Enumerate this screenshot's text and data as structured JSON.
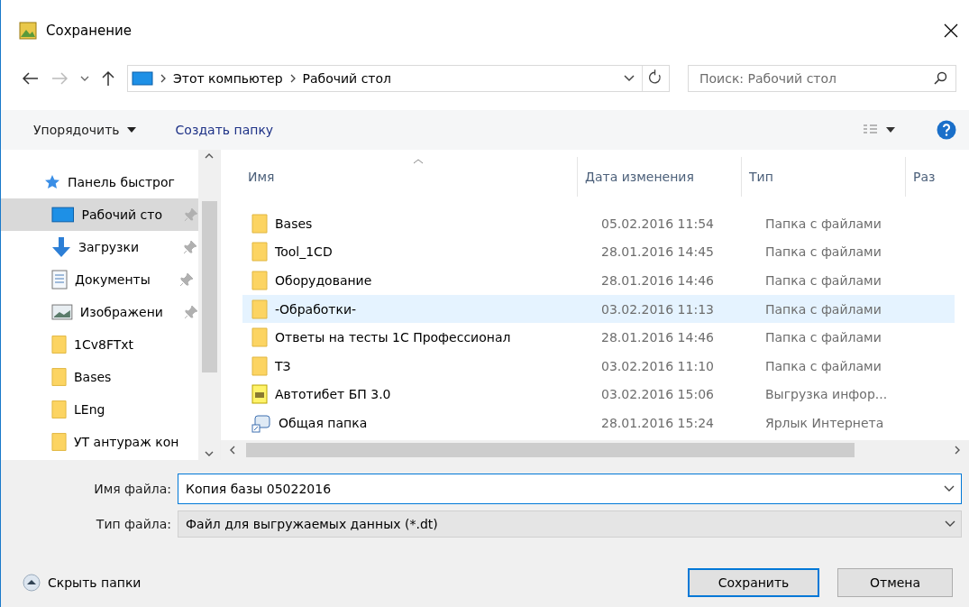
{
  "window": {
    "title": "Сохранение"
  },
  "address": {
    "path": [
      "Этот компьютер",
      "Рабочий стол"
    ]
  },
  "search": {
    "placeholder": "Поиск: Рабочий стол"
  },
  "toolbar": {
    "organize": "Упорядочить",
    "new_folder": "Создать папку"
  },
  "sidebar": {
    "header": "Панель быстрог",
    "items": [
      {
        "label": "Рабочий сто",
        "kind": "desktop",
        "pinned": true,
        "selected": true
      },
      {
        "label": "Загрузки",
        "kind": "download",
        "pinned": true,
        "selected": false
      },
      {
        "label": "Документы",
        "kind": "documents",
        "pinned": true,
        "selected": false
      },
      {
        "label": "Изображени",
        "kind": "pictures",
        "pinned": true,
        "selected": false
      },
      {
        "label": "1Cv8FTxt",
        "kind": "folder",
        "pinned": false,
        "selected": false
      },
      {
        "label": "Bases",
        "kind": "folder",
        "pinned": false,
        "selected": false
      },
      {
        "label": "LEng",
        "kind": "folder",
        "pinned": false,
        "selected": false
      },
      {
        "label": "УТ антураж кон",
        "kind": "folder",
        "pinned": false,
        "selected": false
      }
    ]
  },
  "table": {
    "columns": [
      "Имя",
      "Дата изменения",
      "Тип",
      "Раз"
    ],
    "rows": [
      {
        "name": "Bases",
        "date": "05.02.2016 11:54",
        "type": "Папка с файлами",
        "kind": "folder",
        "selected": false
      },
      {
        "name": "Tool_1CD",
        "date": "28.01.2016 14:45",
        "type": "Папка с файлами",
        "kind": "folder",
        "selected": false
      },
      {
        "name": "Оборудование",
        "date": "28.01.2016 14:46",
        "type": "Папка с файлами",
        "kind": "folder",
        "selected": false
      },
      {
        "name": "-Обработки-",
        "date": "03.02.2016 11:13",
        "type": "Папка с файлами",
        "kind": "folder",
        "selected": true
      },
      {
        "name": "Ответы на тесты 1С Профессионал",
        "date": "28.01.2016 14:46",
        "type": "Папка с файлами",
        "kind": "folder",
        "selected": false
      },
      {
        "name": "ТЗ",
        "date": "03.02.2016 11:10",
        "type": "Папка с файлами",
        "kind": "folder",
        "selected": false
      },
      {
        "name": "Автотибет БП 3.0",
        "date": "03.02.2016 15:06",
        "type": "Выгрузка инфор...",
        "kind": "archive",
        "selected": false
      },
      {
        "name": "Общая папка",
        "date": "28.01.2016 15:24",
        "type": "Ярлык Интернета",
        "kind": "shortcut",
        "selected": false
      }
    ]
  },
  "file_name": {
    "label": "Имя файла:",
    "value": "Копия базы 05022016"
  },
  "file_type": {
    "label": "Тип файла:",
    "value": "Файл для выгружаемых данных (*.dt)"
  },
  "hide_folders": "Скрыть папки",
  "buttons": [
    {
      "label": "Сохранить",
      "default": true
    },
    {
      "label": "Отмена",
      "default": false
    }
  ]
}
